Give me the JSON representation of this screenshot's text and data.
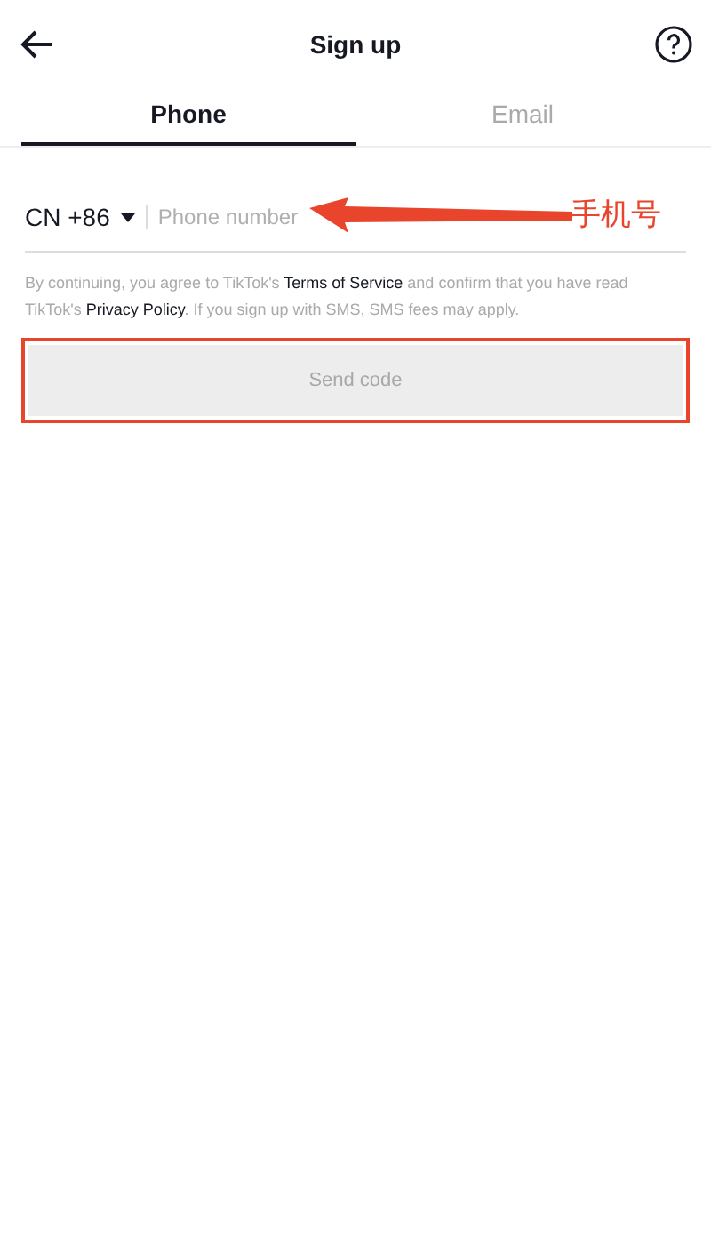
{
  "header": {
    "title": "Sign up"
  },
  "tabs": [
    {
      "label": "Phone",
      "selected": true
    },
    {
      "label": "Email",
      "selected": false
    }
  ],
  "phone": {
    "country_code": "CN +86",
    "placeholder": "Phone number"
  },
  "terms": [
    {
      "kind": "text",
      "text": "By continuing, you agree to TikTok's "
    },
    {
      "kind": "link",
      "text": "Terms of Service"
    },
    {
      "kind": "text",
      "text": " and confirm that you have read TikTok's "
    },
    {
      "kind": "link",
      "text": "Privacy Policy"
    },
    {
      "kind": "text",
      "text": ". If you sign up with SMS, SMS fees may apply."
    }
  ],
  "send_button": {
    "label": "Send code",
    "disabled": true
  },
  "annotation": {
    "label": "手机号"
  }
}
